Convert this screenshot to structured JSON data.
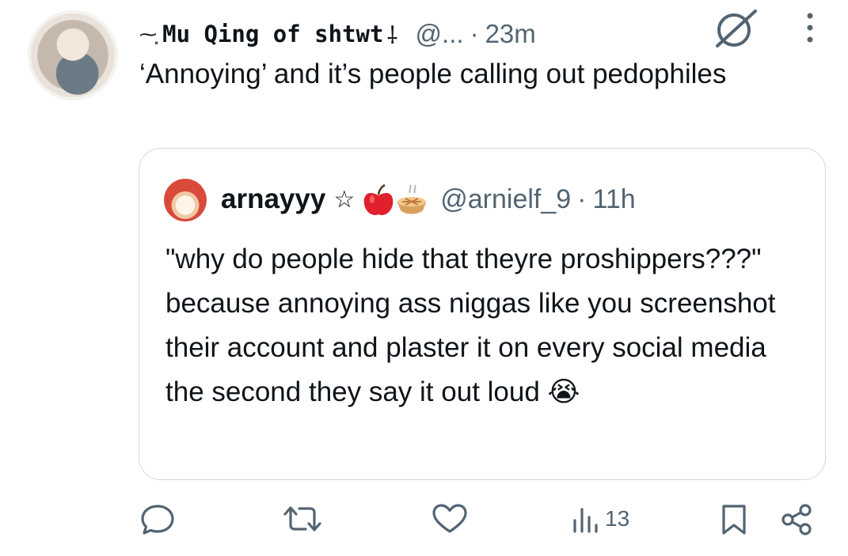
{
  "tweet": {
    "display_name_prefix": "⁓⸼",
    "display_name": "Mu Qing of shtwt",
    "display_name_suffix": "⸸",
    "handle": "@...",
    "time": "23m",
    "text": "‘Annoying’ and it’s people calling out pedophiles",
    "icons": {
      "avatar": "avatar-portrait",
      "bot": "grok-icon",
      "more": "more-vertical-icon"
    }
  },
  "quote": {
    "display_name": "arnayyy",
    "star": "☆",
    "handle": "@arnielf_9",
    "time": "11h",
    "text": "\"why do people hide that theyre proshippers???\" because annoying ass niggas like you screenshot their account and plaster it on every social media the second they say it out loud",
    "emoji_end": "😭"
  },
  "actions": {
    "views": "13",
    "icons": [
      "reply-icon",
      "retweet-icon",
      "like-icon",
      "views-icon",
      "bookmark-icon",
      "share-icon"
    ]
  },
  "colors": {
    "text": "#0f1419",
    "secondary": "#536471",
    "border": "#cfd9de"
  }
}
